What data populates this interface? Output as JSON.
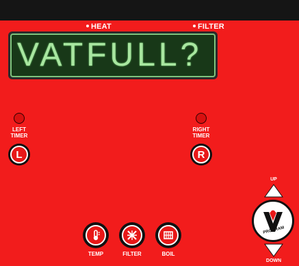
{
  "indicators": {
    "heat": "HEAT",
    "filter": "FILTER"
  },
  "display": {
    "text": "VATFULL?"
  },
  "left_timer": {
    "label_line1": "LEFT",
    "label_line2": "TIMER",
    "button": "L"
  },
  "right_timer": {
    "label_line1": "RIGHT",
    "label_line2": "TIMER",
    "button": "R"
  },
  "functions": {
    "temp": "TEMP",
    "filter": "FILTER",
    "boil": "BOIL"
  },
  "program": {
    "up": "UP",
    "down": "DOWN",
    "label": "PROGRAM",
    "logo": "V"
  },
  "colors": {
    "panel": "#f21c1c",
    "display_text": "#a8e6a0"
  }
}
